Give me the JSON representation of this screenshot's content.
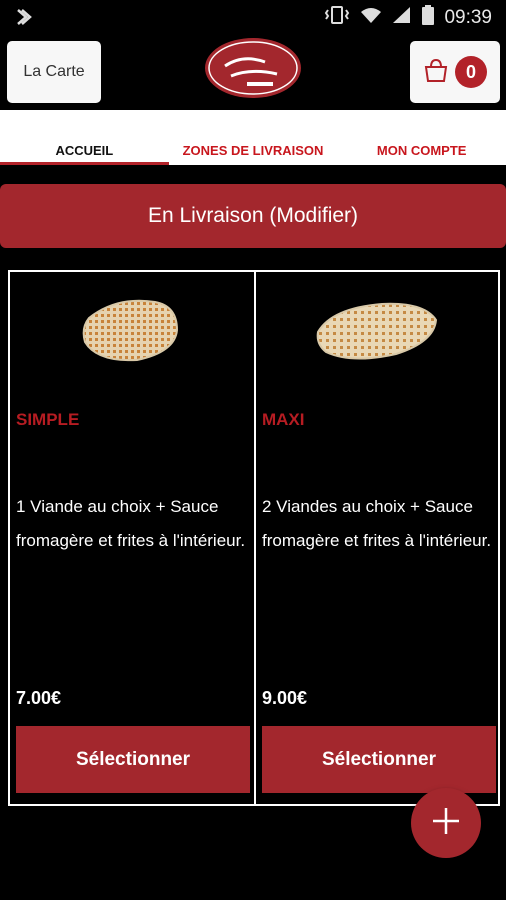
{
  "status_bar": {
    "time": "09:39"
  },
  "header": {
    "menu_label": "La Carte",
    "cart_count": "0"
  },
  "tabs": [
    {
      "label": "ACCUEIL"
    },
    {
      "label": "ZONES DE LIVRAISON"
    },
    {
      "label": "MON COMPTE"
    }
  ],
  "delivery": {
    "label": "En Livraison (Modifier)"
  },
  "products": [
    {
      "name": "SIMPLE",
      "description": "1 Viande au choix + Sauce fromagère et frites à l'intérieur.",
      "price": "7.00€",
      "button": "Sélectionner"
    },
    {
      "name": "MAXI",
      "description": "2 Viandes au choix + Sauce fromagère et frites à l'intérieur.",
      "price": "9.00€",
      "button": "Sélectionner"
    }
  ],
  "colors": {
    "accent": "#a3272d",
    "accent_text": "#c8161d"
  },
  "icons": {
    "fab": "plus-icon",
    "cart": "shopping-bag-icon"
  }
}
